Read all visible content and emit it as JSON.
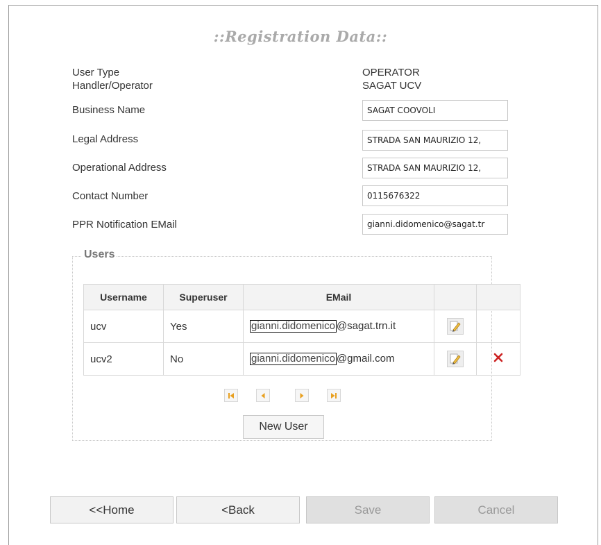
{
  "page": {
    "title": "::Registration Data::"
  },
  "registration": {
    "user_type": {
      "label": "User Type",
      "value": "OPERATOR"
    },
    "handler_operator": {
      "label": "Handler/Operator",
      "value": "SAGAT UCV"
    },
    "business_name": {
      "label": "Business Name",
      "value": "SAGAT COOVOLI"
    },
    "legal_address": {
      "label": "Legal Address",
      "value": "STRADA SAN MAURIZIO 12,"
    },
    "operational_address": {
      "label": "Operational Address",
      "value": "STRADA SAN MAURIZIO 12,"
    },
    "contact_number": {
      "label": "Contact Number",
      "value": "0115676322"
    },
    "ppr_email": {
      "label": "PPR Notification EMail",
      "value": "gianni.didomenico@sagat.tr"
    }
  },
  "users": {
    "legend": "Users",
    "headers": {
      "username": "Username",
      "superuser": "Superuser",
      "email": "EMail"
    },
    "rows": [
      {
        "username": "ucv",
        "superuser": "Yes",
        "email_user": "gianni.didomenico",
        "email_domain": "@sagat.trn.it",
        "deletable": false
      },
      {
        "username": "ucv2",
        "superuser": "No",
        "email_user": "gianni.didomenico",
        "email_domain": "@gmail.com",
        "deletable": true
      }
    ],
    "new_user_label": "New User"
  },
  "nav": {
    "home_label": "<<Home",
    "back_label": "<Back",
    "save_label": "Save",
    "cancel_label": "Cancel"
  },
  "colors": {
    "title": "#aaaaaa",
    "pager_icon": "#e8a020",
    "delete_icon": "#cc2222"
  }
}
